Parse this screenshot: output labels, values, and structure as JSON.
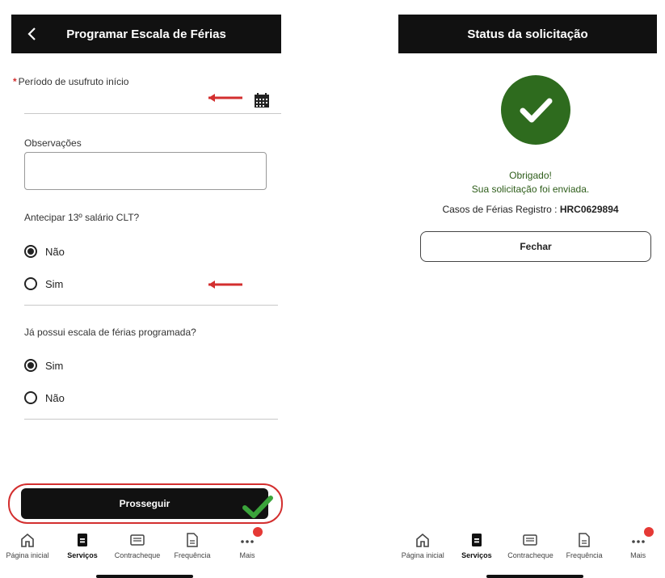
{
  "left": {
    "header": {
      "title": "Programar Escala de Férias"
    },
    "period_field": {
      "required_marker": "*",
      "label": "Período de usufruto início"
    },
    "observations": {
      "label": "Observações",
      "value": ""
    },
    "q13": {
      "label": "Antecipar 13º salário CLT?",
      "options": [
        {
          "label": "Não",
          "selected": true
        },
        {
          "label": "Sim",
          "selected": false
        }
      ]
    },
    "qscale": {
      "label": "Já possui escala de férias programada?",
      "options": [
        {
          "label": "Sim",
          "selected": true
        },
        {
          "label": "Não",
          "selected": false
        }
      ]
    },
    "proceed_label": "Prosseguir"
  },
  "right": {
    "header": {
      "title": "Status da solicitação"
    },
    "thanks_line1": "Obrigado!",
    "thanks_line2": "Sua solicitação foi enviada.",
    "case_prefix": "Casos de Férias Registro : ",
    "case_id": "HRC0629894",
    "close_label": "Fechar"
  },
  "nav": {
    "items": [
      {
        "label": "Página inicial",
        "icon": "home-icon"
      },
      {
        "label": "Serviços",
        "icon": "services-icon",
        "active": true
      },
      {
        "label": "Contracheque",
        "icon": "paycheck-icon"
      },
      {
        "label": "Frequência",
        "icon": "document-icon"
      },
      {
        "label": "Mais",
        "icon": "more-icon"
      }
    ]
  },
  "colors": {
    "header_bg": "#111111",
    "annotation_red": "#d32f2f",
    "success_green": "#2e6b1e",
    "badge_red": "#e53935"
  }
}
